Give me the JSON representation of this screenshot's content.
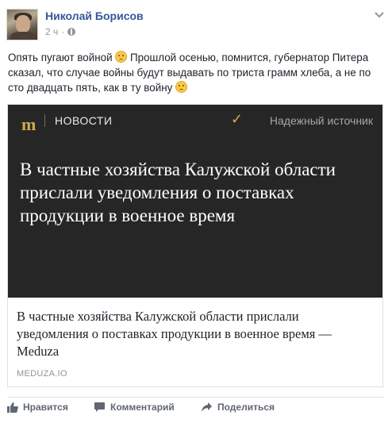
{
  "post": {
    "author": "Николай Борисов",
    "time": "2 ч",
    "text": "Опять пугают войной",
    "text2": " Прошлой осенью, помнится, губернатор Питера сказал, что случае войны будут выдавать по триста грамм хлеба, а не по сто двадцать пять, как в ту войну",
    "emoji": "worried-face-icon",
    "icons": {
      "privacy": "globe-icon",
      "menu": "chevron-down-icon"
    }
  },
  "card": {
    "image": {
      "logo": "m",
      "section": "НОВОСТИ",
      "source": "Надежный источник",
      "headline": "В частные хозяйства Калужской области прислали уведомления о поставках продукции в военное время"
    },
    "title": "В частные хозяйства Калужской области прислали уведомления о поставках продукции в военное время — Meduza",
    "domain": "MEDUZA.IO"
  },
  "actions": {
    "like": "Нравится",
    "comment": "Комментарий",
    "share": "Поделиться"
  },
  "colors": {
    "author": "#365899",
    "meta": "#90949c",
    "card_bg": "#262626",
    "accent": "#d4a94e"
  }
}
